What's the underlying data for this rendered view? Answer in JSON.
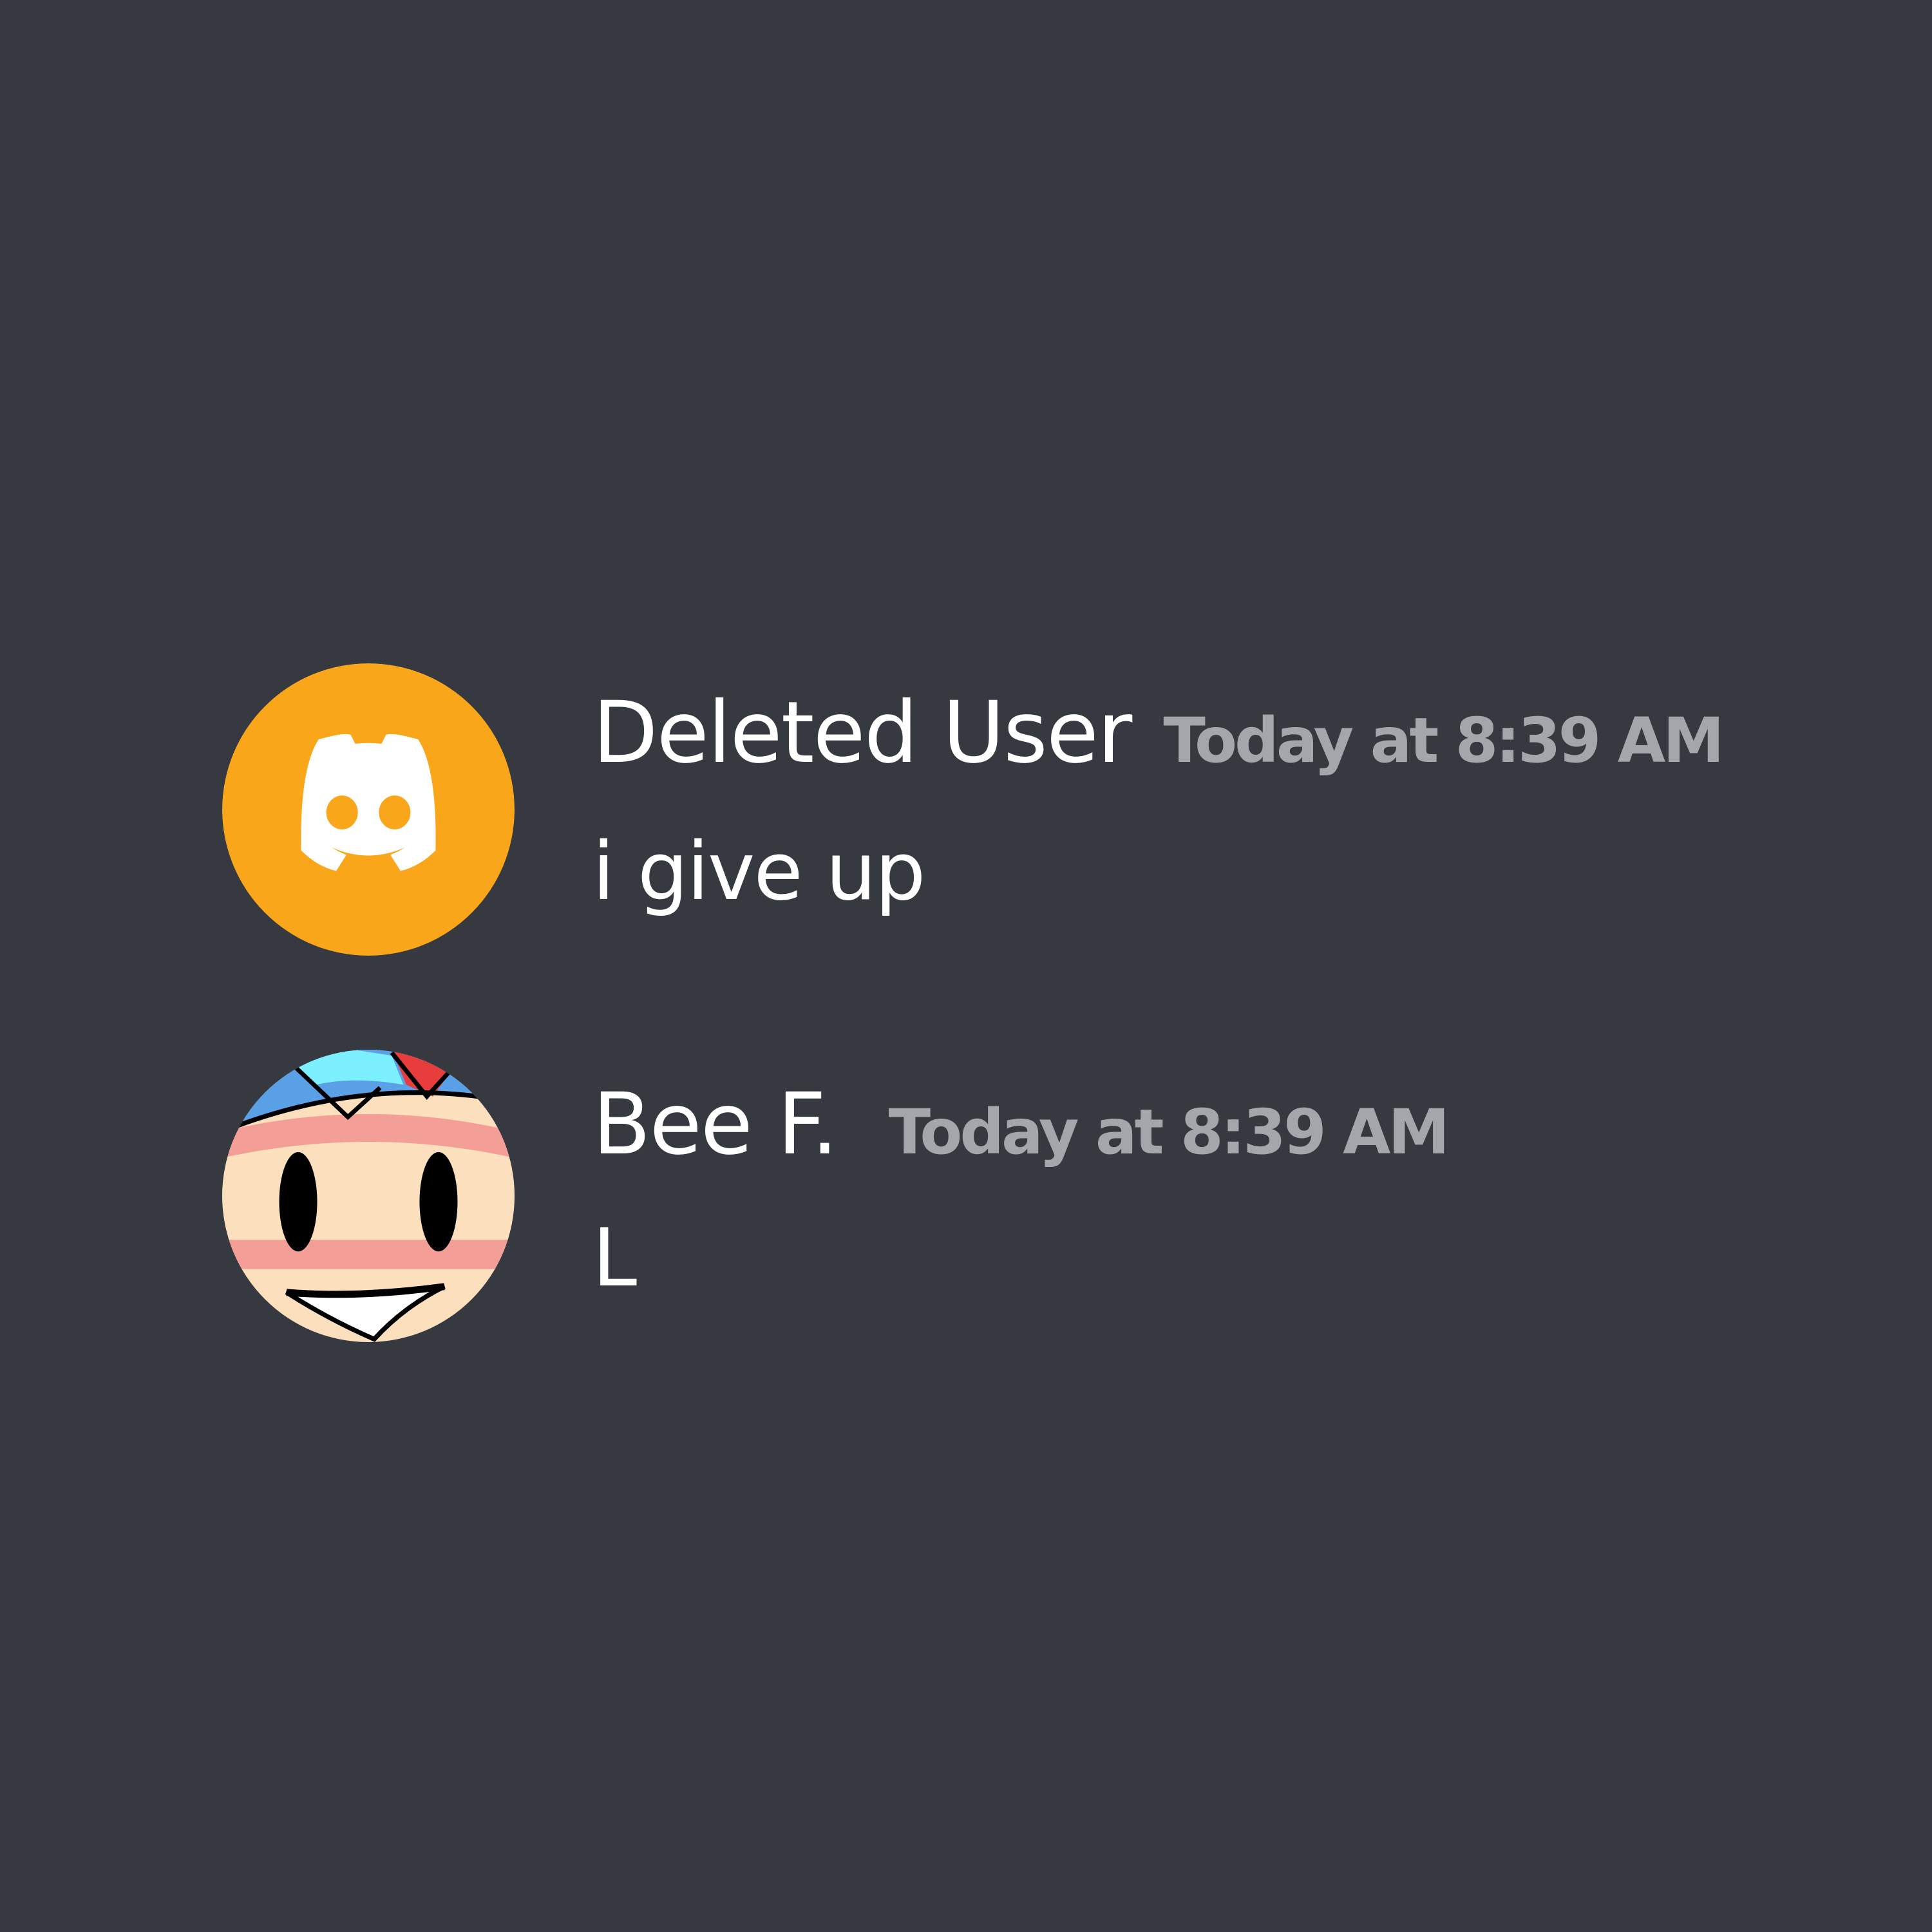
{
  "colors": {
    "background": "#36393f",
    "username": "#ffffff",
    "timestamp": "#a3a6aa",
    "message_text": "#ffffff",
    "default_avatar_bg": "#faa61a"
  },
  "messages": [
    {
      "username": "Deleted User",
      "timestamp": "Today at 8:39 AM",
      "content": "i give up",
      "avatar_icon": "discord-logo-icon"
    },
    {
      "username": "Bee F.",
      "timestamp": "Today at 8:39 AM",
      "content": "L",
      "avatar_icon": "cartoon-face-icon"
    }
  ]
}
